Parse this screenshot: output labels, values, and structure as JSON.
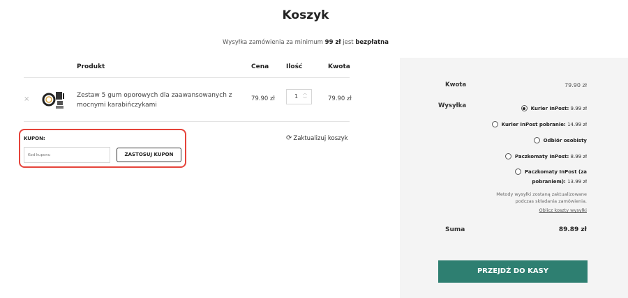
{
  "page": {
    "title": "Koszyk"
  },
  "notice": {
    "prefix": "Wysyłka zamówienia za minimum",
    "amount": "99 zł",
    "middle": "jest",
    "emphasis": "bezpłatna"
  },
  "table": {
    "headers": {
      "product": "Produkt",
      "price": "Cena",
      "qty": "Ilość",
      "amount": "Kwota"
    },
    "items": [
      {
        "remove": "×",
        "name": "Zestaw 5 gum oporowych dla zaawansowanych z mocnymi karabińczykami",
        "price": "79.90 zł",
        "qty": "1",
        "amount": "79.90 zł"
      }
    ]
  },
  "coupon": {
    "label": "KUPON:",
    "placeholder": "Kod kuponu",
    "value": "",
    "button": "ZASTOSUJ KUPON",
    "highlight_color": "#e5433a"
  },
  "update_cart": {
    "icon": "refresh-icon",
    "label": "Zaktualizuj koszyk"
  },
  "summary": {
    "subtotal_label": "Kwota",
    "subtotal_value": "79.90 zł",
    "shipping_label": "Wysyłka",
    "shipping_options": [
      {
        "name": "Kurier InPost:",
        "price": "9.99 zł",
        "selected": true
      },
      {
        "name": "Kurier InPost pobranie:",
        "price": "14.99 zł",
        "selected": false
      },
      {
        "name": "Odbiór osobisty",
        "price": "",
        "selected": false
      },
      {
        "name": "Paczkomaty InPost:",
        "price": "8.99 zł",
        "selected": false
      },
      {
        "name_line1": "Paczkomaty InPost (za",
        "name_line2": "pobraniem):",
        "price": "13.99 zł",
        "selected": false
      }
    ],
    "shipping_note_line1": "Metody wysyłki zostaną zaktualizowane",
    "shipping_note_line2": "podczas składania zamówienia.",
    "calc_link": "Oblicz koszty wysyłki",
    "total_label": "Suma",
    "total_value": "89.89 zł",
    "checkout_button": "PRZEJDŹ DO KASY",
    "accent_color": "#2e7f71"
  }
}
